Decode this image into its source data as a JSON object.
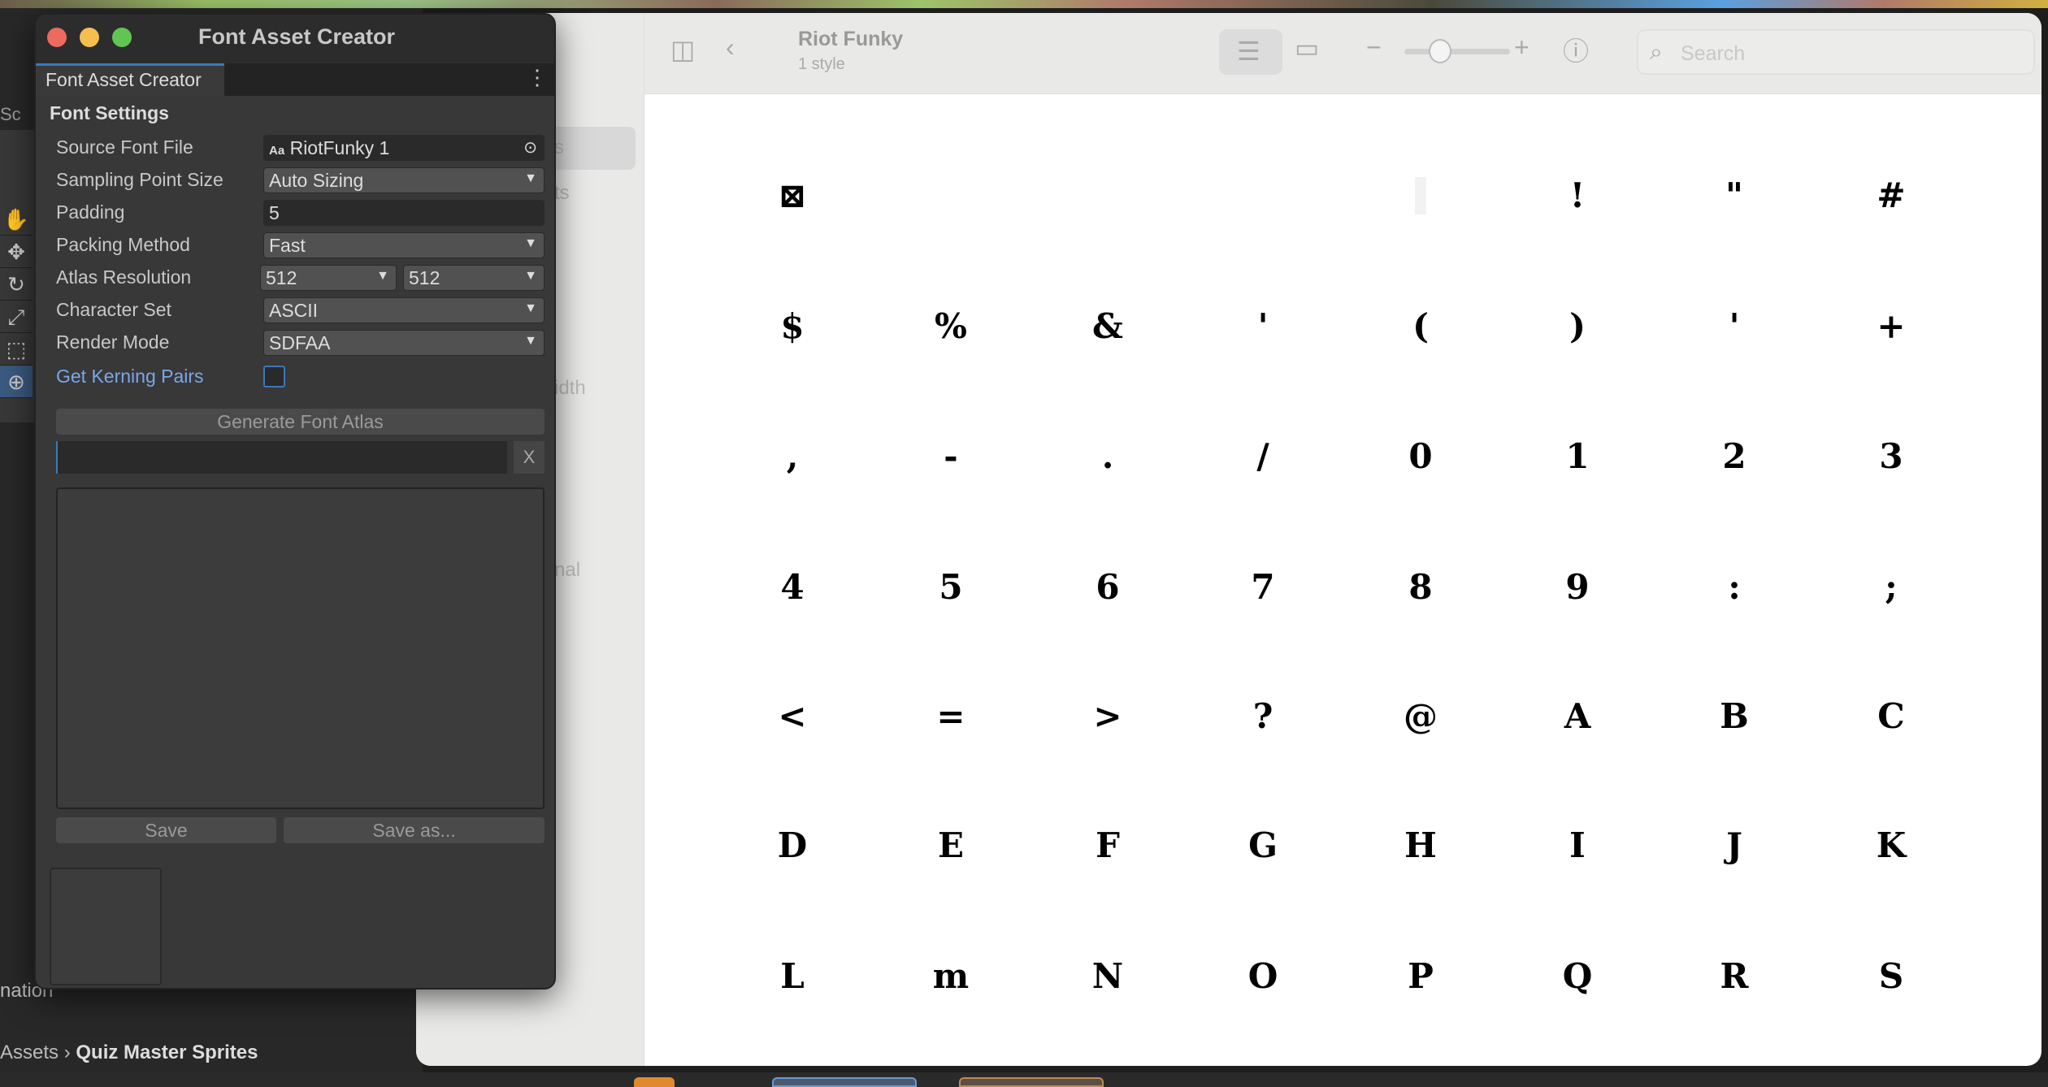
{
  "unity": {
    "window_title": "Font Asset Creator",
    "tab": "Font Asset Creator",
    "section": "Font Settings",
    "fields": [
      {
        "label": "Source Font File",
        "value": "RiotFunky 1",
        "icon": "font-asset-icon",
        "icon_text": "Aa"
      },
      {
        "label": "Sampling Point Size",
        "value": "Auto Sizing"
      },
      {
        "label": "Padding",
        "value": "5"
      },
      {
        "label": "Packing Method",
        "value": "Fast"
      },
      {
        "label": "Atlas Resolution",
        "value": "512",
        "value2": "512"
      },
      {
        "label": "Character Set",
        "value": "ASCII"
      },
      {
        "label": "Render Mode",
        "value": "SDFAA"
      },
      {
        "label": "Get Kerning Pairs",
        "checked": false
      }
    ],
    "generate_label": "Generate Font Atlas",
    "clear_label": "X",
    "save_label": "Save",
    "save_as_label": "Save as...",
    "accent": "#3a79bb",
    "link_color": "#7aa7e8"
  },
  "background": {
    "scene_fragment": "Sc",
    "animation_fragment": "nation",
    "breadcrumb": [
      "Assets",
      "Quiz Master Sprites"
    ]
  },
  "fontbook": {
    "title": "Riot Funky",
    "subtitle": "1 style",
    "search_placeholder": "Search",
    "sidebar_fragments": [
      "s",
      "ts",
      "idth",
      "nal"
    ],
    "glyph_rows": [
      [
        "⊠",
        "",
        "",
        "",
        "",
        "!",
        "\"",
        "#"
      ],
      [
        "$",
        "%",
        "&",
        "'",
        "(",
        ")",
        "'",
        "+"
      ],
      [
        ",",
        "-",
        ".",
        "/",
        "0",
        "1",
        "2",
        "3"
      ],
      [
        "4",
        "5",
        "6",
        "7",
        "8",
        "9",
        ":",
        ";"
      ],
      [
        "<",
        "=",
        ">",
        "?",
        "@",
        "A",
        "B",
        "C"
      ],
      [
        "D",
        "E",
        "F",
        "G",
        "H",
        "I",
        "J",
        "K"
      ],
      [
        "L",
        "m",
        "N",
        "O",
        "P",
        "Q",
        "R",
        "S"
      ]
    ]
  }
}
